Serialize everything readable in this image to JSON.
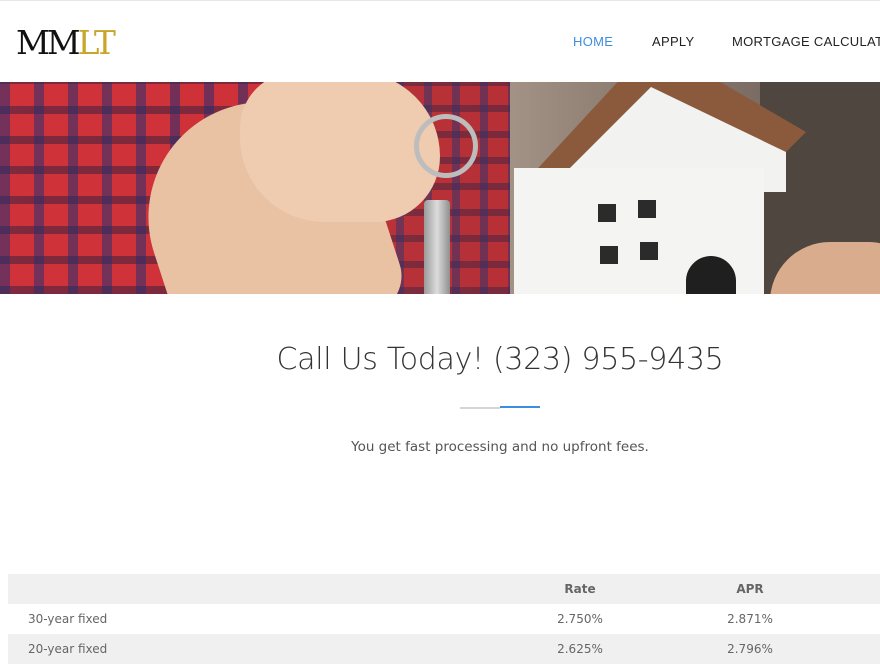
{
  "header": {
    "logo": {
      "part1": "MM",
      "part2": "LT"
    },
    "nav": [
      {
        "label": "HOME",
        "active": true
      },
      {
        "label": "APPLY",
        "active": false
      },
      {
        "label": "MORTGAGE CALCULATOR",
        "active": false
      }
    ]
  },
  "call": {
    "title": "Call Us Today! (323) 955-9435",
    "tagline": "You get fast processing and no upfront fees."
  },
  "rates": {
    "columns": {
      "term": "",
      "rate": "Rate",
      "apr": "APR"
    },
    "rows": [
      {
        "term": "30-year fixed",
        "rate": "2.750%",
        "apr": "2.871%"
      },
      {
        "term": "20-year fixed",
        "rate": "2.625%",
        "apr": "2.796%"
      }
    ]
  },
  "colors": {
    "accent": "#3d8ede",
    "logo_gold": "#c9a52a"
  },
  "icons": [
    "logo-mark"
  ]
}
